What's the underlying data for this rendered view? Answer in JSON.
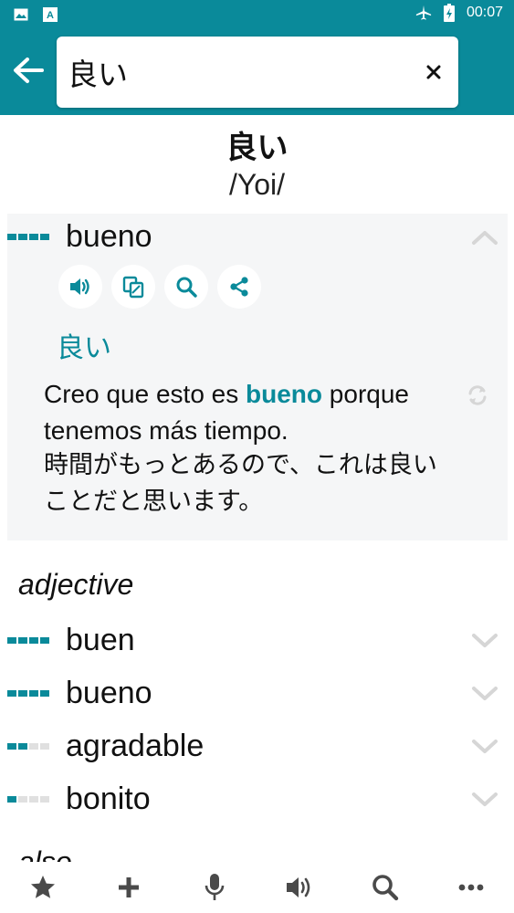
{
  "status_bar": {
    "time": "00:07",
    "icons": [
      "image-icon",
      "text-icon",
      "airplane-icon",
      "battery-icon"
    ]
  },
  "search": {
    "value": "良い"
  },
  "entry": {
    "headword": "良い",
    "reading": "/Yoi/",
    "main_translation": {
      "word": "bueno",
      "frequency": 4,
      "japanese": "良い",
      "example_before": "Creo que esto es ",
      "example_highlight": "bueno",
      "example_after": " porque tenemos más tiempo.",
      "example_jp": "時間がもっとあるので、これは良いことだと思います。",
      "actions": [
        "speaker-icon",
        "copy-icon",
        "search-icon",
        "share-icon"
      ]
    },
    "part_of_speech": "adjective",
    "translations": [
      {
        "word": "buen",
        "frequency": 4
      },
      {
        "word": "bueno",
        "frequency": 4
      },
      {
        "word": "agradable",
        "frequency": 2
      },
      {
        "word": "bonito",
        "frequency": 1
      }
    ],
    "next_section_partial": "also"
  },
  "bottom_nav": [
    "star-icon",
    "plus-icon",
    "microphone-icon",
    "speaker-icon",
    "search-icon",
    "more-icon"
  ],
  "colors": {
    "accent": "#0a8a9a",
    "card_bg": "#f5f6f7",
    "inactive_bar": "#e0e0e0"
  }
}
